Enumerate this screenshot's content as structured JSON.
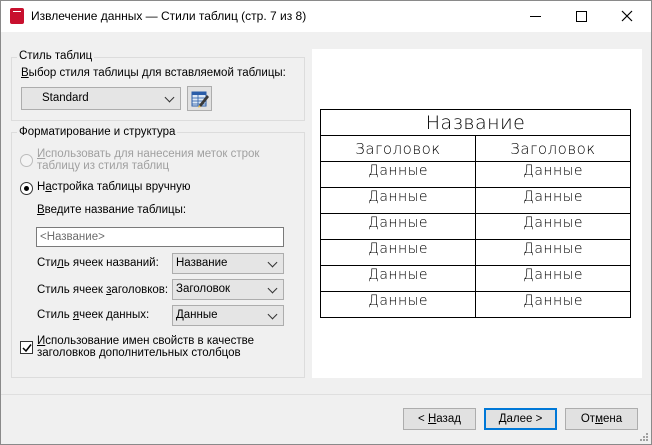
{
  "window": {
    "title": "Извлечение данных — Стили таблиц (стр. 7 из 8)",
    "app_icon": "autocad-icon",
    "controls": {
      "minimize": "minimize-icon",
      "maximize": "maximize-icon",
      "close": "close-icon"
    }
  },
  "table_style_group": {
    "title": "Стиль таблиц",
    "select_label_prefix": "",
    "select_label_u": "В",
    "select_label_rest": "ыбор стиля таблицы для вставляемой таблицы:",
    "style_value": "Standard",
    "edit_button_icon": "table-style-edit-icon"
  },
  "format_group": {
    "title": "Форматирование и структура",
    "radio_use_style_u": "И",
    "radio_use_style_rest_line1": "спользовать для нанесения меток строк",
    "radio_use_style_line2": "таблицу из стиля таблиц",
    "radio_use_style_checked": false,
    "radio_use_style_enabled": false,
    "radio_manual_prefix": "Н",
    "radio_manual_u": "а",
    "radio_manual_rest": "стройка таблицы вручную",
    "radio_manual_checked": true,
    "table_name_prefix": "",
    "table_name_u": "В",
    "table_name_rest": "ведите название таблицы:",
    "table_name_placeholder": "<Название>",
    "table_name_value": "",
    "title_cell_prefix": "Сти",
    "title_cell_u": "л",
    "title_cell_rest": "ь ячеек названий:",
    "title_cell_value": "Название",
    "header_cell_prefix": "Стиль ячеек ",
    "header_cell_u": "з",
    "header_cell_rest": "аголовков:",
    "header_cell_value": "Заголовок",
    "data_cell_prefix": "Стиль ",
    "data_cell_u": "я",
    "data_cell_rest": "чеек данных:",
    "data_cell_value": "Данные",
    "checkbox_u": "И",
    "checkbox_rest_line1": "спользование имен свойств в качестве",
    "checkbox_line2": "заголовков дополнительных столбцов",
    "checkbox_checked": true
  },
  "preview": {
    "title": "Название",
    "headers": [
      "Заголовок",
      "Заголовок"
    ],
    "rows": [
      [
        "Данные",
        "Данные"
      ],
      [
        "Данные",
        "Данные"
      ],
      [
        "Данные",
        "Данные"
      ],
      [
        "Данные",
        "Данные"
      ],
      [
        "Данные",
        "Данные"
      ],
      [
        "Данные",
        "Данные"
      ]
    ]
  },
  "footer": {
    "back_prefix": "< ",
    "back_u": "Н",
    "back_rest": "азад",
    "next_u": "Д",
    "next_rest": "алее >",
    "cancel_prefix": "От",
    "cancel_u": "м",
    "cancel_rest": "ена"
  }
}
